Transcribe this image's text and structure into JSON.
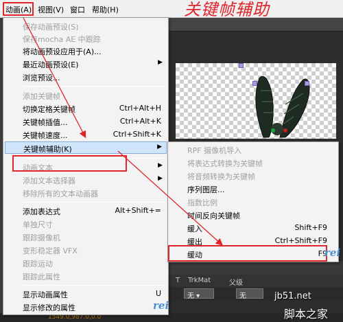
{
  "menubar": {
    "items": [
      "动画(A)",
      "视图(V)",
      "窗口",
      "帮助(H)"
    ],
    "watermark_text": "关键帧辅助"
  },
  "animation_menu": {
    "items": [
      {
        "label": "保存动画预设(S)",
        "shortcut": "",
        "disabled": true
      },
      {
        "label": "保存mocha AE 中跟踪",
        "shortcut": "",
        "disabled": true
      },
      {
        "label": "将动画预设应用于(A)...",
        "shortcut": "",
        "disabled": false
      },
      {
        "label": "最近动画预设(E)",
        "shortcut": "",
        "disabled": false,
        "submenu": true
      },
      {
        "label": "浏览预设...",
        "shortcut": "",
        "disabled": false
      },
      {
        "label": "添加关键帧",
        "shortcut": "",
        "disabled": true
      },
      {
        "label": "切换定格关键帧",
        "shortcut": "Ctrl+Alt+H",
        "disabled": false
      },
      {
        "label": "关键帧插值...",
        "shortcut": "Ctrl+Alt+K",
        "disabled": false
      },
      {
        "label": "关键帧速度...",
        "shortcut": "Ctrl+Shift+K",
        "disabled": false
      },
      {
        "label": "关键帧辅助(K)",
        "shortcut": "",
        "disabled": false,
        "submenu": true,
        "selected": true
      },
      {
        "label": "动画文本",
        "shortcut": "",
        "disabled": true,
        "submenu": true
      },
      {
        "label": "添加文本选择器",
        "shortcut": "",
        "disabled": true,
        "submenu": true
      },
      {
        "label": "移除所有的文本动画器",
        "shortcut": "",
        "disabled": true
      },
      {
        "label": "添加表达式",
        "shortcut": "Alt+Shift+=",
        "disabled": false
      },
      {
        "label": "单独尺寸",
        "shortcut": "",
        "disabled": true
      },
      {
        "label": "跟踪摄像机",
        "shortcut": "",
        "disabled": true
      },
      {
        "label": "变形稳定器 VFX",
        "shortcut": "",
        "disabled": true
      },
      {
        "label": "跟踪运动",
        "shortcut": "",
        "disabled": true
      },
      {
        "label": "跟踪此属性",
        "shortcut": "",
        "disabled": true
      },
      {
        "label": "显示动画属性",
        "shortcut": "U",
        "disabled": false
      },
      {
        "label": "显示修改的属性",
        "shortcut": "",
        "disabled": false
      }
    ]
  },
  "keyframe_assistant_submenu": {
    "items": [
      {
        "label": "RPF 摄像机导入",
        "shortcut": "",
        "disabled": true
      },
      {
        "label": "将表达式转换为关键帧",
        "shortcut": "",
        "disabled": true
      },
      {
        "label": "将音频转换为关键帧",
        "shortcut": "",
        "disabled": true
      },
      {
        "label": "序列图层...",
        "shortcut": "",
        "disabled": false
      },
      {
        "label": "指数比例",
        "shortcut": "",
        "disabled": true
      },
      {
        "label": "时间反向关键帧",
        "shortcut": "",
        "disabled": false
      },
      {
        "label": "缓入",
        "shortcut": "Shift+F9",
        "disabled": false
      },
      {
        "label": "缓出",
        "shortcut": "Ctrl+Shift+F9",
        "disabled": false
      },
      {
        "label": "缓动",
        "shortcut": "F9",
        "disabled": false
      }
    ]
  },
  "timeline": {
    "header_t": "T",
    "header_trkmat": "TrkMat",
    "header_parent": "父级",
    "trkmat_value": "无",
    "parent_value": "无",
    "coord_readout": "1549.0,987.0,0.0"
  },
  "watermarks": {
    "rei": "rei",
    "site": "jb51.net",
    "site_cn": "脚本之家"
  },
  "colors": {
    "annotation_red": "#e0242c",
    "highlight_blue": "#cfe5fb"
  }
}
